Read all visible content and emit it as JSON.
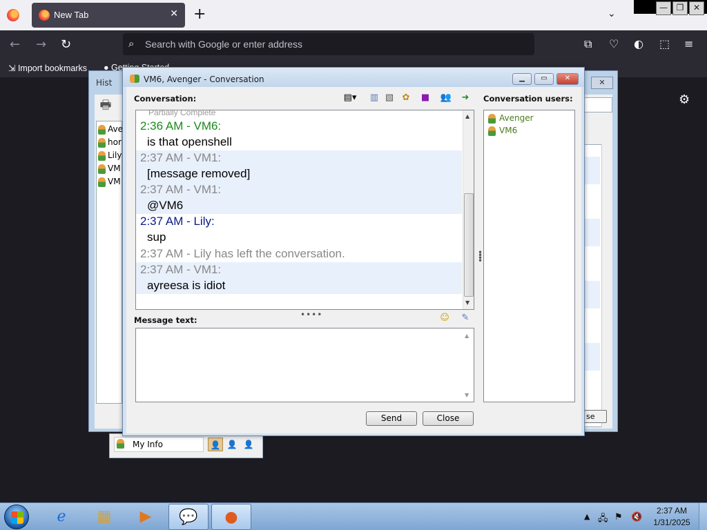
{
  "browser": {
    "tab_title": "New Tab",
    "tab_close": "✕",
    "new_tab": "+",
    "tab_list": "⌄",
    "window_buttons": {
      "minimize": "—",
      "maximize": "❐",
      "close": "✕"
    },
    "nav": {
      "back": "←",
      "forward": "→",
      "reload": "↻"
    },
    "url_placeholder": "Search with Google or enter address",
    "bookmarks": {
      "import": "Import bookmarks",
      "getting_started": "Getting Started"
    },
    "right_icons": [
      "picture-in-picture-icon",
      "pocket-icon",
      "vpn-icon",
      "extensions-icon",
      "menu-icon"
    ]
  },
  "background_window": {
    "title": "Hist",
    "close": "✕",
    "contacts": [
      "Ave",
      "hor",
      "Lily",
      "VM",
      "VM"
    ],
    "close_button": "se"
  },
  "my_info": {
    "label": "My Info"
  },
  "conversation": {
    "title": "VM6, Avenger - Conversation",
    "conversation_label": "Conversation:",
    "users_label": "Conversation users:",
    "message_label": "Message text:",
    "partial_top": "Partially Complete",
    "messages": [
      {
        "header": "2:36 AM - VM6:",
        "text": "is that openshell",
        "color": "#1a8a1a"
      },
      {
        "header": "2:37 AM - VM1:",
        "text": "[message removed]",
        "color": "#888888"
      },
      {
        "header": "2:37 AM - VM1:",
        "text": "@VM6",
        "color": "#888888"
      },
      {
        "header": "2:37 AM - Lily:",
        "text": "sup",
        "color": "#0a1a8a"
      }
    ],
    "system_message": "2:37 AM - Lily has left the conversation.",
    "last_message": {
      "header": "2:37 AM - VM1:",
      "text": "ayreesa is idiot",
      "color": "#888888"
    },
    "users": [
      "Avenger",
      "VM6"
    ],
    "send_button": "Send",
    "close_button": "Close",
    "splitter": "••••"
  },
  "taskbar": {
    "apps": [
      "internet-explorer",
      "file-explorer",
      "media-player",
      "chat-app",
      "firefox"
    ],
    "clock_time": "2:37 AM",
    "clock_date": "1/31/2025"
  },
  "colors": {
    "browser_bg": "#1c1b22",
    "toolbar": "#2b2a33",
    "window_frame": "#d4e2f2",
    "taskbar": "#8eb2da"
  }
}
